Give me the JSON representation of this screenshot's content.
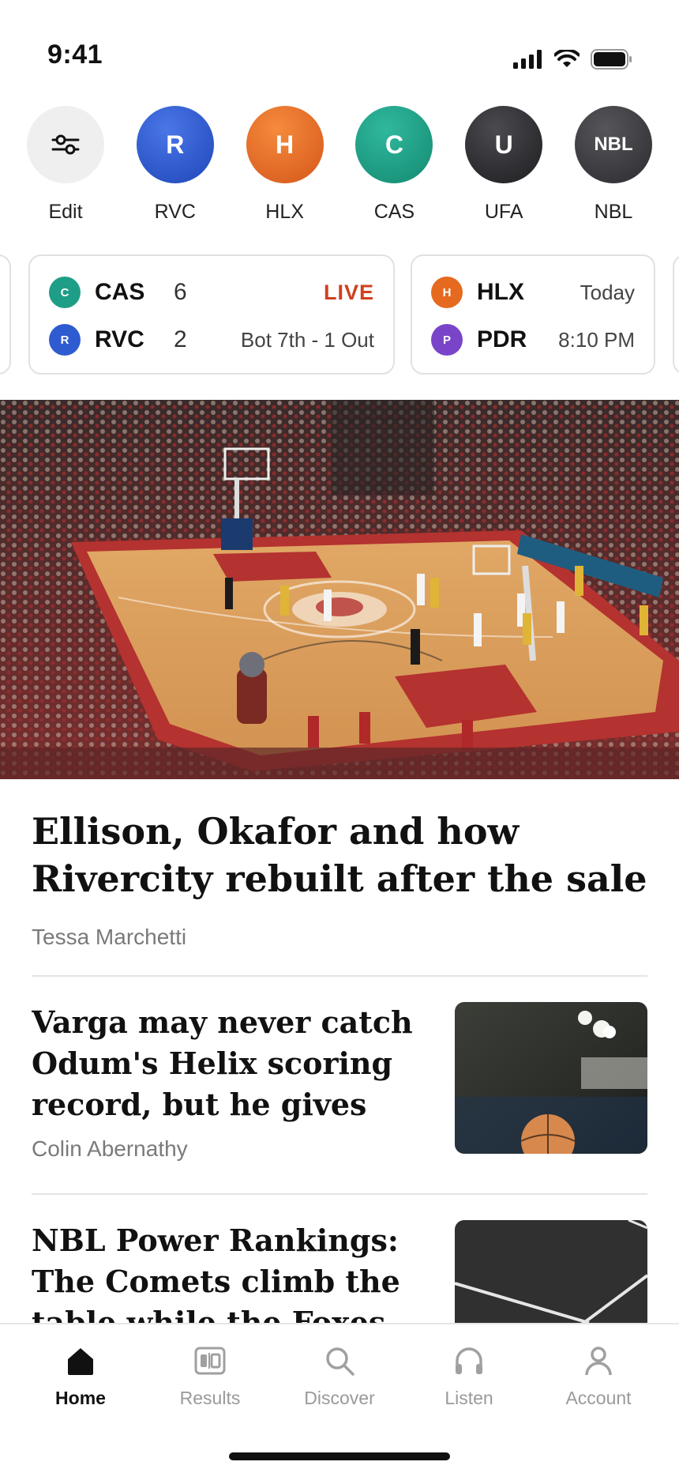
{
  "status_bar": {
    "time": "9:41"
  },
  "teams": [
    {
      "label": "Edit",
      "initial": "",
      "color": "#efefef"
    },
    {
      "label": "RVC",
      "initial": "R",
      "color": "#2f5bd0"
    },
    {
      "label": "HLX",
      "initial": "H",
      "color": "#e56a1f"
    },
    {
      "label": "CAS",
      "initial": "C",
      "color": "#1e9e86"
    },
    {
      "label": "UFA",
      "initial": "U",
      "color": "#2b2b2e"
    },
    {
      "label": "NBL",
      "initial": "NBL",
      "color": "#3a3a3e"
    }
  ],
  "scores": {
    "live_game": {
      "team1": {
        "logo": "C",
        "abbr": "CAS",
        "score": "6",
        "color": "#1e9e86"
      },
      "team2": {
        "logo": "R",
        "abbr": "RVC",
        "score": "2",
        "color": "#2f5bd0"
      },
      "status_top": "LIVE",
      "status_bottom": "Bot 7th - 1 Out"
    },
    "upcoming_game": {
      "team1": {
        "logo": "H",
        "abbr": "HLX",
        "color": "#e56a1f"
      },
      "team2": {
        "logo": "P",
        "abbr": "PDR",
        "color": "#7a44c9"
      },
      "day": "Today",
      "time": "8:10 PM"
    }
  },
  "main_story": {
    "headline": "Ellison, Okafor and how Rivercity rebuilt after the sale",
    "author": "Tessa Marchetti"
  },
  "stories": [
    {
      "headline": "Varga may never catch Odum's Helix scoring record, but he gives th…",
      "author": "Colin Abernathy"
    },
    {
      "headline": "NBL Power Rankings: The Comets climb the table while the Foxes",
      "author": ""
    }
  ],
  "tab_bar": {
    "tabs": [
      {
        "label": "Home",
        "icon": "home-icon",
        "active": true
      },
      {
        "label": "Results",
        "icon": "scoreboard-icon",
        "active": false
      },
      {
        "label": "Discover",
        "icon": "search-icon",
        "active": false
      },
      {
        "label": "Listen",
        "icon": "headphones-icon",
        "active": false
      },
      {
        "label": "Account",
        "icon": "person-icon",
        "active": false
      }
    ]
  }
}
